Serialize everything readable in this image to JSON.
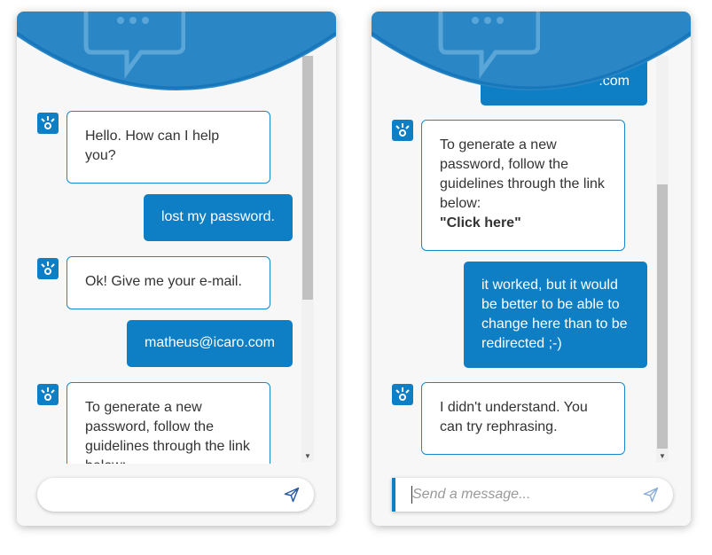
{
  "left_chat": {
    "messages": [
      {
        "from": "bot",
        "text": "Hello. How can I help you?"
      },
      {
        "from": "user",
        "text": "lost my password."
      },
      {
        "from": "bot",
        "text": "Ok! Give me your e-mail."
      },
      {
        "from": "user",
        "text": "matheus@icaro.com"
      },
      {
        "from": "bot",
        "text": "To generate a new password, follow the guidelines through the link below:"
      }
    ],
    "input": {
      "value": "",
      "placeholder": ""
    }
  },
  "right_chat": {
    "messages": [
      {
        "from": "user",
        "text": ".com"
      },
      {
        "from": "bot",
        "text": "To generate a new password, follow the guidelines through the link below:",
        "link": "\"Click here\""
      },
      {
        "from": "user",
        "text": "it worked, but it would be better to be able to change here than to be redirected ;-)"
      },
      {
        "from": "bot",
        "text": "I didn't understand. You can try rephrasing."
      }
    ],
    "input": {
      "value": "",
      "placeholder": "Send a message..."
    }
  },
  "colors": {
    "accent": "#0e7ec5",
    "header": "#2b86c5",
    "panel_bg": "#f7f7f7"
  },
  "icons": [
    "chat-bubble-icon",
    "bot-icon",
    "send-icon"
  ]
}
